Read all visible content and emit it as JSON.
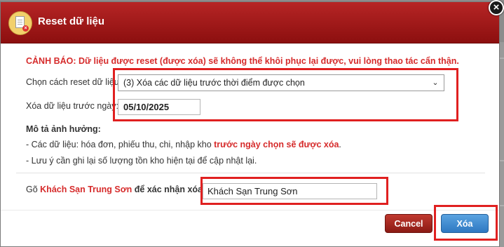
{
  "dialog": {
    "title": "Reset dữ liệu",
    "close_symbol": "×",
    "title_icon": "document-reset-icon"
  },
  "warning_text": "CẢNH BÁO: Dữ liệu được reset (được xóa) sẽ không thể khôi phục lại được, vui lòng thao tác cẩn thận.",
  "reset_method": {
    "label": "Chọn cách reset dữ liệu",
    "selected": "(3) Xóa các dữ liệu trước thời điểm được chọn"
  },
  "delete_before": {
    "label": "Xóa dữ liệu trước ngày:",
    "value": "05/10/2025"
  },
  "impact": {
    "heading": "Mô tả ảnh hưởng:",
    "line1_prefix": "- Các dữ liệu: hóa đơn, phiếu thu, chi, nhập kho ",
    "line1_red": "trước ngày chọn sẽ được xóa",
    "line1_suffix": ".",
    "line2": "- Lưu ý cần ghi lại số lượng tồn kho hiện tại để cập nhật lại."
  },
  "confirm": {
    "prefix": "Gõ ",
    "hotel_name": "Khách Sạn Trung Sơn",
    "suffix": " để xác nhận xóa:",
    "input_value": "Khách Sạn Trung Sơn"
  },
  "buttons": {
    "cancel": "Cancel",
    "delete": "Xóa"
  },
  "colors": {
    "title_bar": "#a51c1c",
    "warning_red": "#d62b2b",
    "highlight_red": "#e02020",
    "delete_blue": "#3a86d0"
  }
}
